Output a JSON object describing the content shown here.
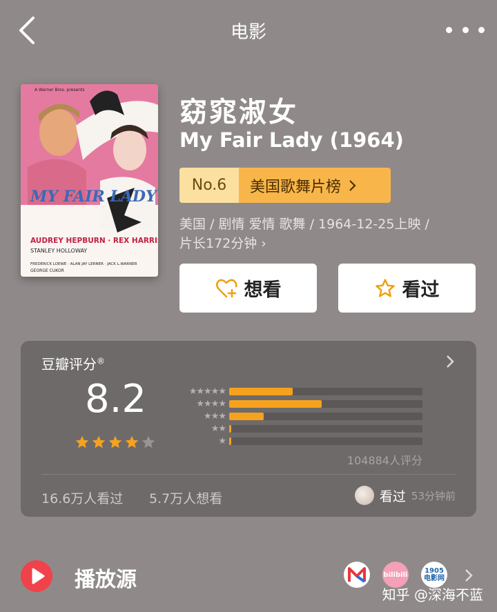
{
  "header": {
    "title": "电影"
  },
  "movie": {
    "zh_title": "窈窕淑女",
    "en_title": "My Fair Lady (1964)",
    "rank_no": "No.6",
    "rank_list": "美国歌舞片榜",
    "meta_line1": "美国 / 剧情 爱情 歌舞 / 1964-12-25上映 /",
    "meta_line2": "片长172分钟 ›",
    "poster": {
      "top_credit": "A Warner Bros. presents",
      "title": "MY FAIR LADY",
      "stars_line": "AUDREY HEPBURN · REX HARRISON",
      "support_line": "STANLEY HOLLOWAY",
      "credits_line1": "FREDERICK LOEWE · ALAN JAY LERNER · JACK L.WARNER",
      "credits_line2": "GEORGE CUKOR"
    }
  },
  "actions": {
    "want": "想看",
    "seen": "看过"
  },
  "rating": {
    "header": "豆瓣评分",
    "header_mark": "®",
    "score": "8.2",
    "stars_value": 4.1,
    "distribution": [
      {
        "stars": "★★★★★",
        "pct": 0.33
      },
      {
        "stars": "★★★★",
        "pct": 0.48
      },
      {
        "stars": "★★★",
        "pct": 0.18
      },
      {
        "stars": "★★",
        "pct": 0.01
      },
      {
        "stars": "★",
        "pct": 0.005
      }
    ],
    "count_label": "104884人评分",
    "seen_count": "16.6万人看过",
    "want_count": "5.7万人想看",
    "friend_action": "看过",
    "friend_time": "53分钟前"
  },
  "source": {
    "label": "播放源",
    "logos": [
      "M",
      "bilibili",
      "1905 电影网"
    ]
  },
  "watermark": "知乎 @深海不蓝",
  "colors": {
    "accent": "#f6a21e",
    "rank_bg": "#f8b64a",
    "play": "#f0424a",
    "background": "#8f8a89"
  }
}
